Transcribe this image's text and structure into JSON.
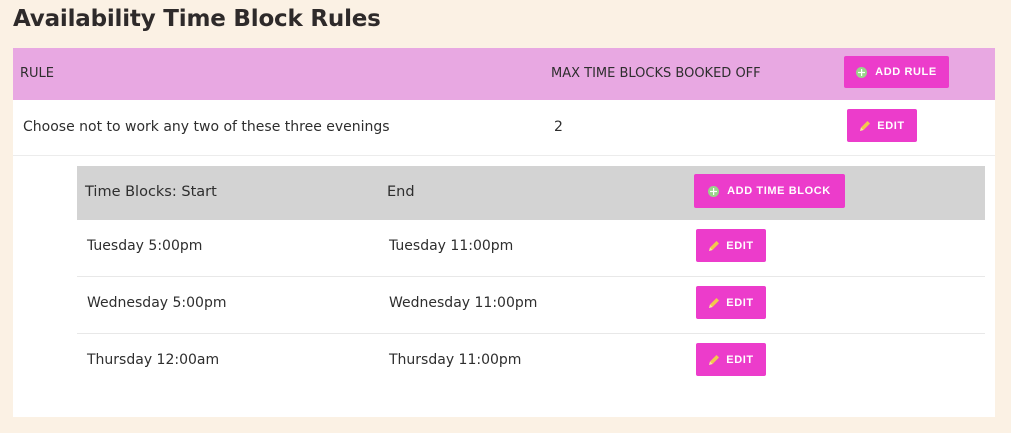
{
  "page": {
    "title": "Availability Time Block Rules"
  },
  "rules_table": {
    "header": {
      "rule": "RULE",
      "max_blocks": "MAX TIME BLOCKS BOOKED OFF",
      "add_rule_label": "ADD RULE"
    },
    "rows": [
      {
        "rule": "Choose not to work any two of these three evenings",
        "max_blocks": "2",
        "edit_label": "EDIT"
      }
    ]
  },
  "time_blocks": {
    "header": {
      "start": "Time Blocks: Start",
      "end": "End",
      "add_label": "ADD TIME BLOCK"
    },
    "rows": [
      {
        "start": "Tuesday 5:00pm",
        "end": "Tuesday 11:00pm",
        "edit_label": "EDIT"
      },
      {
        "start": "Wednesday 5:00pm",
        "end": "Wednesday 11:00pm",
        "edit_label": "EDIT"
      },
      {
        "start": "Thursday 12:00am",
        "end": "Thursday 11:00pm",
        "edit_label": "EDIT"
      }
    ]
  },
  "colors": {
    "page_background": "#fbf1e4",
    "rule_header": "#e8a8e2",
    "button": "#ec3ccb",
    "time_block_header": "#d3d3d3",
    "plus_icon": "#9ad48a",
    "pencil_icon": "#f2c94c"
  },
  "icons": {
    "add": "plus-circle-icon",
    "edit": "pencil-icon"
  }
}
